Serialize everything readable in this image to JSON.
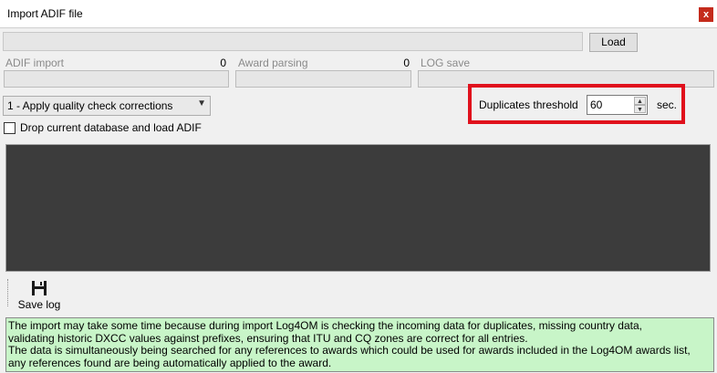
{
  "window": {
    "title": "Import ADIF file",
    "close_glyph": "x"
  },
  "file": {
    "path": "",
    "load_label": "Load"
  },
  "progress": [
    {
      "label": "ADIF import",
      "count": "0"
    },
    {
      "label": "Award parsing",
      "count": "0"
    },
    {
      "label": "LOG save",
      "count": ""
    }
  ],
  "import_mode": {
    "selected": "1 - Apply quality check corrections"
  },
  "duplicates": {
    "label": "Duplicates threshold",
    "value": "60",
    "unit": "sec.",
    "highlight_color": "#e0101c"
  },
  "drop_db": {
    "label": "Drop current database and load ADIF",
    "checked": false
  },
  "toolbar": {
    "save_log_label": "Save log",
    "save_icon": "floppy-disk-icon"
  },
  "info": {
    "lines": [
      "The import may take some time because during  import Log4OM is checking the incoming data for duplicates, missing country data,",
      "validating historic DXCC values against prefixes, ensuring that ITU and CQ zones are correct for all entries.",
      "The data is simultaneously being searched for any references to awards which could be used for awards included in the Log4OM awards list,",
      "any references found are being automatically applied to the award."
    ],
    "background": "#c8f5c8"
  }
}
